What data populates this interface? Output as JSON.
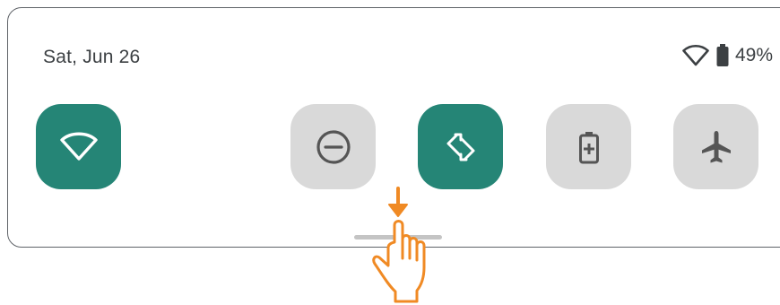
{
  "header": {
    "date": "Sat, Jun 26",
    "battery_percent": "49%"
  },
  "status_icons": [
    "wifi-outline-icon",
    "battery-icon"
  ],
  "tiles": [
    {
      "name": "wifi",
      "icon": "wifi-icon",
      "state": "on"
    },
    {
      "name": "do-not-disturb",
      "icon": "minus-circle-icon",
      "state": "off"
    },
    {
      "name": "auto-rotate",
      "icon": "rotate-icon",
      "state": "on"
    },
    {
      "name": "battery-saver",
      "icon": "battery-plus-icon",
      "state": "off"
    },
    {
      "name": "airplane-mode",
      "icon": "airplane-icon",
      "state": "off"
    }
  ],
  "colors": {
    "tile_on": "#258576",
    "tile_off": "#d9d9d9",
    "gesture": "#f08a24"
  },
  "gesture": {
    "icon": "swipe-down-hand-icon",
    "direction": "down"
  }
}
